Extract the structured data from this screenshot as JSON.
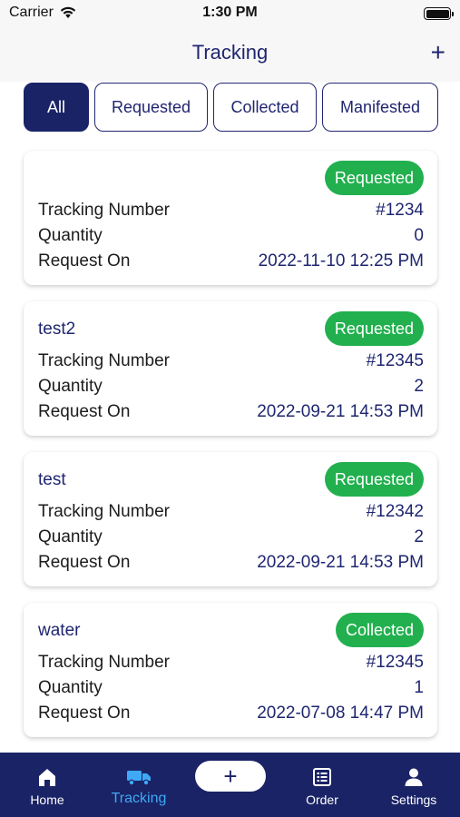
{
  "status_bar": {
    "carrier": "Carrier",
    "time": "1:30 PM"
  },
  "header": {
    "title": "Tracking",
    "add_label": "+"
  },
  "filters": [
    {
      "label": "All",
      "active": true
    },
    {
      "label": "Requested",
      "active": false
    },
    {
      "label": "Collected",
      "active": false
    },
    {
      "label": "Manifested",
      "active": false
    }
  ],
  "cards": [
    {
      "name": "",
      "status": "Requested",
      "tracking_label": "Tracking Number",
      "tracking": "#1234",
      "quantity_label": "Quantity",
      "quantity": "0",
      "request_label": "Request On",
      "request_on": "2022-11-10 12:25 PM"
    },
    {
      "name": "test2",
      "status": "Requested",
      "tracking_label": "Tracking Number",
      "tracking": "#12345",
      "quantity_label": "Quantity",
      "quantity": "2",
      "request_label": "Request On",
      "request_on": "2022-09-21 14:53 PM"
    },
    {
      "name": "test",
      "status": "Requested",
      "tracking_label": "Tracking Number",
      "tracking": "#12342",
      "quantity_label": "Quantity",
      "quantity": "2",
      "request_label": "Request On",
      "request_on": "2022-09-21 14:53 PM"
    },
    {
      "name": "water",
      "status": "Collected",
      "tracking_label": "Tracking Number",
      "tracking": "#12345",
      "quantity_label": "Quantity",
      "quantity": "1",
      "request_label": "Request On",
      "request_on": "2022-07-08 14:47 PM"
    }
  ],
  "tabbar": {
    "home": "Home",
    "tracking": "Tracking",
    "center_add": "+",
    "order": "Order",
    "settings": "Settings"
  },
  "colors": {
    "primary": "#1a2366",
    "accent_blue": "#3fa9f5",
    "status_green": "#22b04f",
    "nav_background": "#f7f7f7"
  },
  "icons": {
    "status": [
      "wifi-icon",
      "battery-icon"
    ],
    "tabs": [
      "home-icon",
      "truck-icon",
      "plus-icon",
      "order-list-icon",
      "person-icon"
    ]
  }
}
